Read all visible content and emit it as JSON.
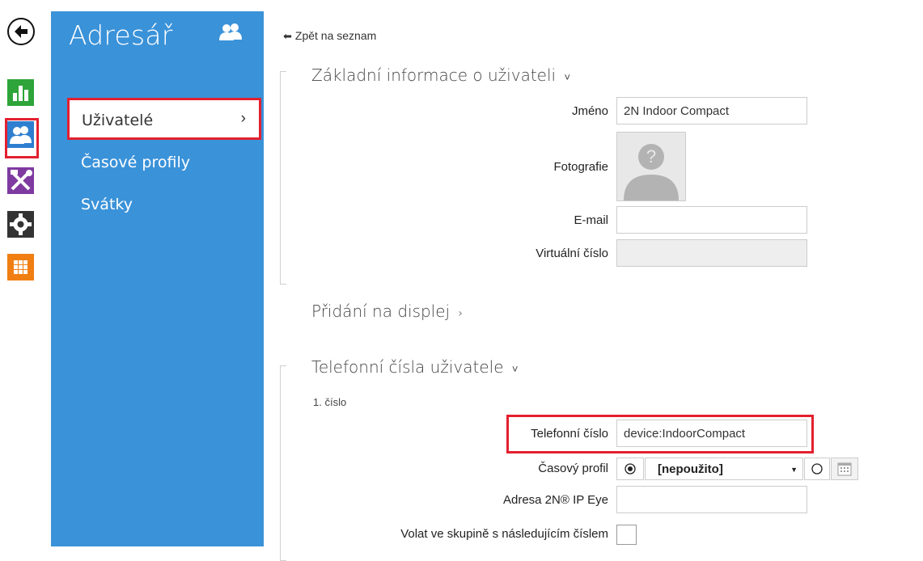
{
  "app": {
    "title": "Adresář",
    "title_icon": "users-icon"
  },
  "rail": {
    "back_icon": "back-arrow-icon",
    "items": [
      {
        "icon": "status-chart-icon",
        "color": "#2ea43a"
      },
      {
        "icon": "users-icon",
        "color": "#2f7fd0",
        "active": true
      },
      {
        "icon": "tools-icon",
        "color": "#7e3aa0"
      },
      {
        "icon": "gear-icon",
        "color": "#333333"
      },
      {
        "icon": "grid-icon",
        "color": "#f07e12"
      }
    ]
  },
  "menu": {
    "items": [
      {
        "label": "Uživatelé",
        "chevron": "›",
        "active": true
      },
      {
        "label": "Časové profily"
      },
      {
        "label": "Svátky"
      }
    ]
  },
  "main": {
    "back_link": "Zpět na seznam",
    "sections": {
      "basic": {
        "title": "Základní informace o uživateli",
        "toggle": "˅"
      },
      "display": {
        "title": "Přidání na displej",
        "toggle": "›"
      },
      "phones": {
        "title": "Telefonní čísla uživatele",
        "toggle": "˅"
      }
    },
    "fields": {
      "name": {
        "label": "Jméno",
        "value": "2N Indoor Compact"
      },
      "photo": {
        "label": "Fotografie"
      },
      "email": {
        "label": "E-mail",
        "value": ""
      },
      "virtual": {
        "label": "Virtuální číslo",
        "value": ""
      }
    },
    "phone1": {
      "sub_label": "1. číslo",
      "number": {
        "label": "Telefonní číslo",
        "value": "device:IndoorCompact"
      },
      "time_profile": {
        "label": "Časový profil",
        "selected": "[nepoužito]"
      },
      "ip_eye": {
        "label": "Adresa 2N® IP Eye",
        "value": ""
      },
      "group_call": {
        "label": "Volat ve skupině s následujícím číslem",
        "checked": false
      }
    }
  },
  "colors": {
    "accent_blue": "#3a92d9",
    "highlight_red": "#e3202f"
  }
}
